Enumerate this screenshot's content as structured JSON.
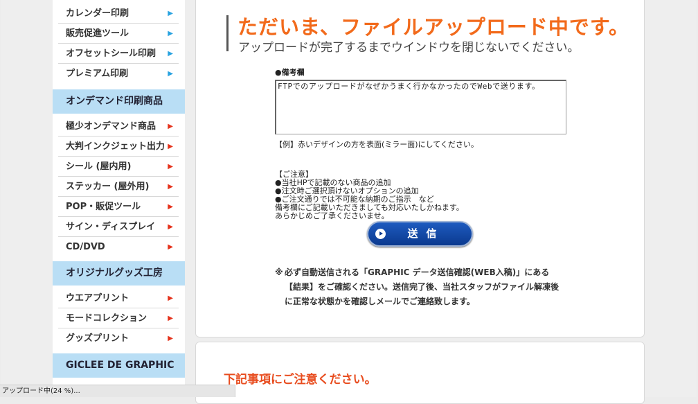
{
  "sidebar": {
    "group1": [
      {
        "label": "カレンダー印刷",
        "arrow": "▶"
      },
      {
        "label": "販売促進ツール",
        "arrow": "▶"
      },
      {
        "label": "オフセットシール印刷",
        "arrow": "▶"
      },
      {
        "label": "プレミアム印刷",
        "arrow": "▶"
      }
    ],
    "section_ondemand": "オンデマンド印刷商品",
    "group2": [
      {
        "label": "極少オンデマンド商品",
        "arrow": "▶"
      },
      {
        "label": "大判インクジェット出力",
        "arrow": "▶"
      },
      {
        "label": "シール (屋内用)",
        "arrow": "▶"
      },
      {
        "label": "ステッカー (屋外用)",
        "arrow": "▶"
      },
      {
        "label": "POP・販促ツール",
        "arrow": "▶"
      },
      {
        "label": "サイン・ディスプレイ",
        "arrow": "▶"
      },
      {
        "label": "CD/DVD",
        "arrow": "▶"
      }
    ],
    "section_goods": "オリジナルグッズ工房",
    "group3": [
      {
        "label": "ウエアプリント",
        "arrow": "▶"
      },
      {
        "label": "モードコレクション",
        "arrow": "▶"
      },
      {
        "label": "グッズプリント",
        "arrow": "▶"
      }
    ],
    "section_giclee": "GICLEE DE GRAPHIC"
  },
  "main": {
    "heading": "ただいま、ファイルアップロード中です。",
    "subheading": "アップロードが完了するまでウインドウを閉じないでください。",
    "remarks_label": "●備考欄",
    "remarks_value": "FTPでのアップロードがなぜかうまく行かなかったのでWebで送ります。",
    "example": "【例】赤いデザインの方を表面(ミラー面)にしてください。",
    "notice_lines": [
      "【ご注意】",
      "●当社HPで記載のない商品の追加",
      "●注文時ご選択頂けないオプションの追加",
      "●ご注文通りでは不可能な納期のご指示　など",
      "備考欄にご記載いただきましても対応いたしかねます。",
      "あらかじめご了承くださいませ。"
    ],
    "send_button": "送信",
    "note_mark": "※",
    "note_text": "必ず自動送信される「GRAPHIC データ送信確認(WEB入稿)」にある【結果】をご確認ください。送信完了後、当社スタッフがファイル解凍後に正常な状態かを確認しメールでご連絡致します。",
    "warning_title": "下記事項にご注意ください。"
  },
  "status_bar": "アップロード中(24 %)...",
  "colors": {
    "accent_orange": "#f26a1b",
    "section_blue": "#b9def5",
    "arrow_blue": "#2aa3e0",
    "arrow_red": "#e5331d",
    "button_blue": "#0b3a8f"
  }
}
